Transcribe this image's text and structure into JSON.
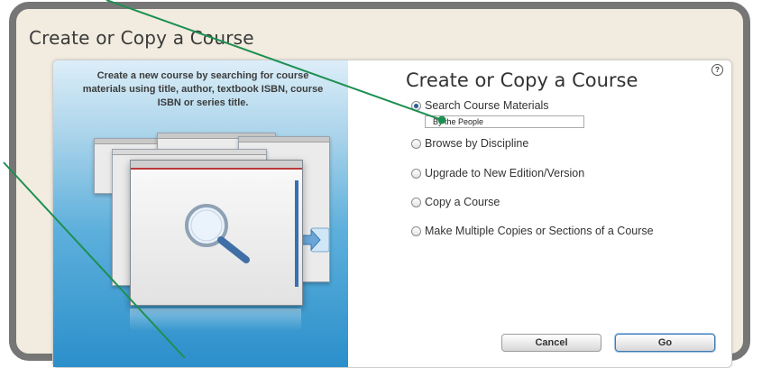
{
  "page": {
    "title": "Create or Copy a Course"
  },
  "illustration": {
    "description": "Create a new course by searching for course materials using title, author, textbook ISBN, course ISBN or series title."
  },
  "dialog": {
    "title": "Create or Copy a Course",
    "help_label": "?",
    "options": [
      {
        "label": "Search Course Materials",
        "selected": true
      },
      {
        "label": "Browse by Discipline",
        "selected": false
      },
      {
        "label": "Upgrade to New Edition/Version",
        "selected": false
      },
      {
        "label": "Copy a Course",
        "selected": false
      },
      {
        "label": "Make Multiple Copies or Sections of a Course",
        "selected": false
      }
    ],
    "search": {
      "value": "By the People"
    },
    "buttons": {
      "cancel": "Cancel",
      "go": "Go"
    }
  },
  "colors": {
    "frame": "#767676",
    "page_background": "#f1ecdf",
    "annotation_line": "#1e8f52",
    "radio_selected": "#2f5d97"
  }
}
